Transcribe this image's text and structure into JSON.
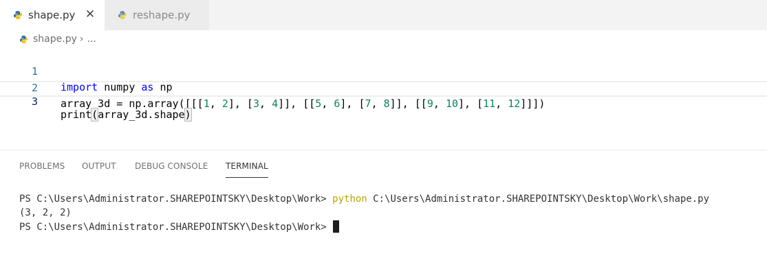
{
  "tabs": [
    {
      "label": "shape.py",
      "active": true,
      "close_glyph": "✕"
    },
    {
      "label": "reshape.py",
      "active": false
    }
  ],
  "breadcrumb": {
    "file": "shape.py",
    "separator": "›",
    "more": "..."
  },
  "editor": {
    "lines": [
      {
        "number": "1"
      },
      {
        "number": "2"
      },
      {
        "number": "3"
      }
    ],
    "code": {
      "l1_import": "import",
      "l1_module": " numpy ",
      "l1_as": "as",
      "l1_alias": " np",
      "l2_prefix": "array_3d = np.array([[[",
      "l2_n1": "1",
      "l2_s1": ", ",
      "l2_n2": "2",
      "l2_s2": "], [",
      "l2_n3": "3",
      "l2_s3": ", ",
      "l2_n4": "4",
      "l2_s4": "]], [[",
      "l2_n5": "5",
      "l2_s5": ", ",
      "l2_n6": "6",
      "l2_s6": "], [",
      "l2_n7": "7",
      "l2_s7": ", ",
      "l2_n8": "8",
      "l2_s8": "]], [[",
      "l2_n9": "9",
      "l2_s9": ", ",
      "l2_n10": "10",
      "l2_s10": "], [",
      "l2_n11": "11",
      "l2_s11": ", ",
      "l2_n12": "12",
      "l2_s12": "]]])",
      "l3_print": "print",
      "l3_open": "(",
      "l3_arg": "array_3d.shape",
      "l3_close": ")"
    }
  },
  "panel": {
    "tabs": [
      {
        "label": "PROBLEMS"
      },
      {
        "label": "OUTPUT"
      },
      {
        "label": "DEBUG CONSOLE"
      },
      {
        "label": "TERMINAL",
        "active": true
      }
    ]
  },
  "terminal": {
    "prompt": "PS C:\\Users\\Administrator.SHAREPOINTSKY\\Desktop\\Work> ",
    "command": "python",
    "command_arg": " C:\\Users\\Administrator.SHAREPOINTSKY\\Desktop\\Work\\shape.py",
    "output": "(3, 2, 2)",
    "prompt2": "PS C:\\Users\\Administrator.SHAREPOINTSKY\\Desktop\\Work> "
  },
  "colors": {
    "keyword": "#0000ff",
    "number": "#098658",
    "line_number": "#237893",
    "python_command": "#b8a600",
    "python_icon_blue": "#3572a5",
    "python_icon_yellow": "#f0c419"
  },
  "icons": {
    "tab_file_icon": "python-icon",
    "tab_close_icon": "close-icon"
  }
}
